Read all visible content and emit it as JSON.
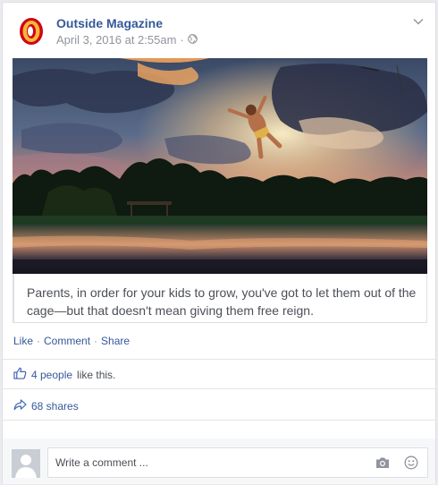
{
  "post": {
    "page_name": "Outside Magazine",
    "timestamp": "April 3, 2016 at 2:55am",
    "meta_separator": "·",
    "privacy_icon": "globe-icon",
    "caption": "Parents, in order for your kids to grow, you've got to let them out of the cage—but that doesn't mean giving them free reign."
  },
  "actions": {
    "like": "Like",
    "comment": "Comment",
    "share": "Share",
    "separator": "·"
  },
  "stats": {
    "likes_link": "4 people",
    "likes_suffix": "like this.",
    "shares": "68 shares"
  },
  "comment": {
    "placeholder": "Write a comment ..."
  },
  "colors": {
    "link": "#365899",
    "logo_orange": "#f5a623",
    "logo_red": "#d0021b"
  }
}
